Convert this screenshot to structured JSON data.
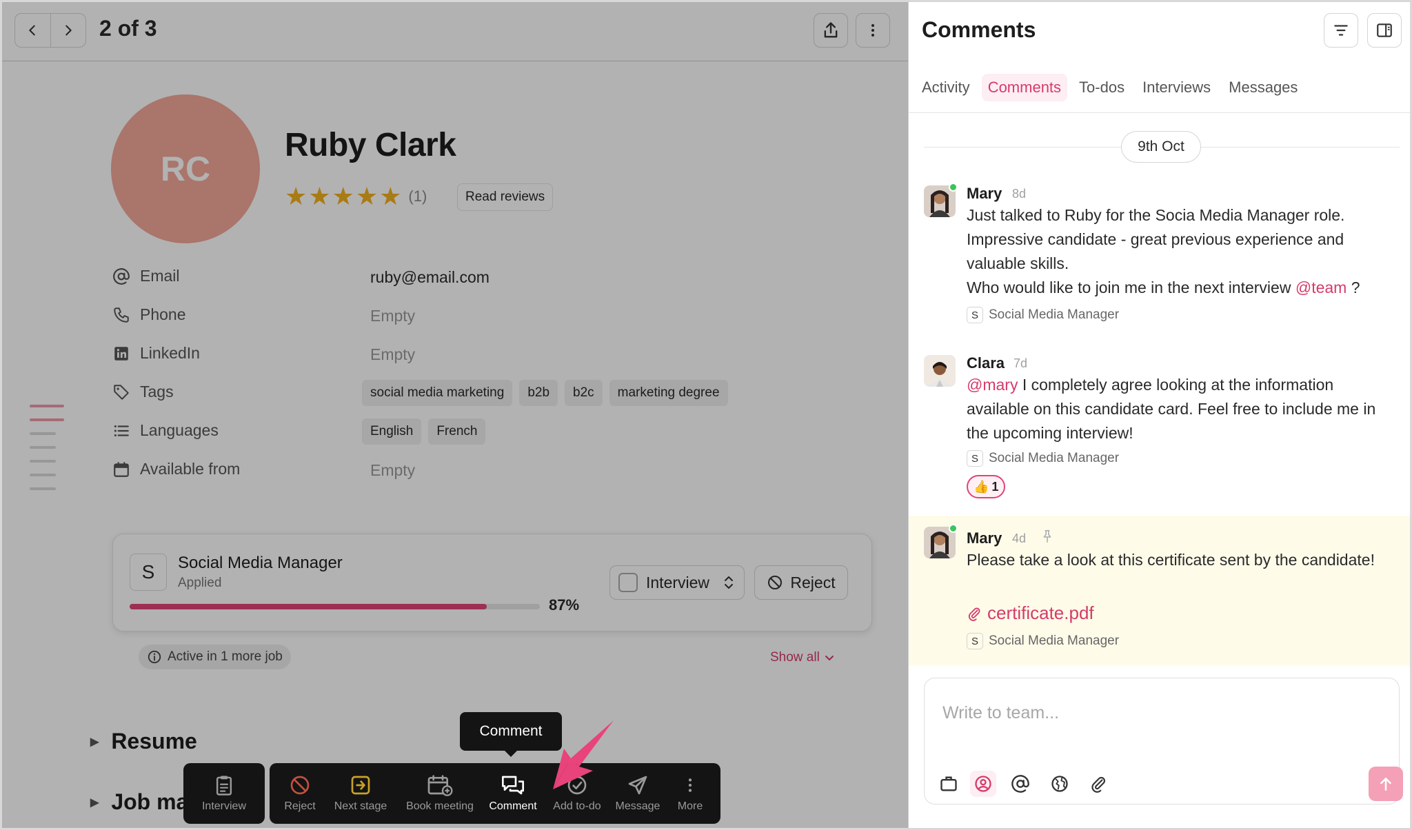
{
  "topbar": {
    "counter": "2 of 3"
  },
  "candidate": {
    "initials": "RC",
    "name": "Ruby Clark",
    "rating_stars": 5,
    "rating_count": "(1)",
    "read_reviews_label": "Read reviews",
    "avatar_color": "#f4a89a"
  },
  "fields": {
    "email": {
      "label": "Email",
      "value": "ruby@email.com"
    },
    "phone": {
      "label": "Phone",
      "value": "Empty"
    },
    "linkedin": {
      "label": "LinkedIn",
      "value": "Empty"
    },
    "tags": {
      "label": "Tags",
      "values": [
        "social media marketing",
        "b2b",
        "b2c",
        "marketing degree"
      ]
    },
    "languages": {
      "label": "Languages",
      "values": [
        "English",
        "French"
      ]
    },
    "available": {
      "label": "Available from",
      "value": "Empty"
    }
  },
  "job": {
    "badge": "S",
    "title": "Social Media Manager",
    "status": "Applied",
    "progress_pct": 87,
    "progress_label": "87%",
    "stage": "Interview",
    "reject_label": "Reject",
    "active_jobs": "Active in 1 more job",
    "show_all": "Show all"
  },
  "sections": {
    "resume": "Resume",
    "job_partial": "Job ma"
  },
  "toolbar": {
    "tooltip": "Comment",
    "interview": "Interview",
    "reject": "Reject",
    "next_stage": "Next stage",
    "book_meeting": "Book meeting",
    "comment": "Comment",
    "add_todo": "Add to-do",
    "message": "Message",
    "more": "More"
  },
  "comments_panel": {
    "title": "Comments",
    "tabs": [
      "Activity",
      "Comments",
      "To-dos",
      "Interviews",
      "Messages"
    ],
    "active_tab": "Comments",
    "date": "9th Oct",
    "comments": [
      {
        "author": "Mary",
        "time": "8d",
        "line1": "Just talked to Ruby for the Socia Media Manager role.",
        "line2": "Impressive candidate - great previous experience and",
        "line3": "valuable skills.",
        "line4_pre": "Who would like to join me in the next interview",
        "mention": "@team",
        "line4_post": "?",
        "tag_badge": "S",
        "tag": "Social Media Manager"
      },
      {
        "author": "Clara",
        "time": "7d",
        "mention": "@mary",
        "text_after_mention": "I completely agree looking at the information available on this candidate card. Feel free to include me in the upcoming interview!",
        "tag_badge": "S",
        "tag": "Social Media Manager",
        "reaction_emoji": "👍",
        "reaction_count": "1"
      },
      {
        "author": "Mary",
        "time": "4d",
        "text": "Please take a look at this certificate sent by the candidate!",
        "attachment": "certificate.pdf",
        "tag_badge": "S",
        "tag": "Social Media Manager"
      }
    ],
    "composer_placeholder": "Write to team..."
  },
  "colors": {
    "accent": "#d63b6b",
    "progress": "#e04476",
    "pinned_bg": "#fefbe9",
    "star": "#f2b01e",
    "online": "#3cc45c"
  },
  "icons": {
    "prev": "chevron-left-icon",
    "next": "chevron-right-icon",
    "share": "share-icon",
    "more": "more-vertical-icon",
    "filter": "filter-icon",
    "panel": "panel-toggle-icon"
  }
}
